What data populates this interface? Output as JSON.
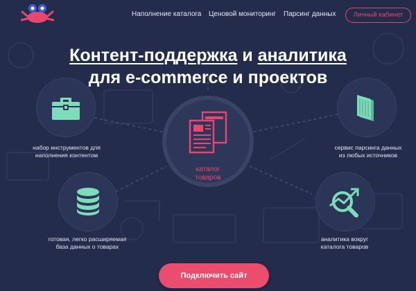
{
  "nav": {
    "links": [
      "Наполнение каталога",
      "Ценовой мониторинг",
      "Парсинг данных"
    ],
    "cabinet_label": "Личный кабинет"
  },
  "hero": {
    "line1_a": "Контент-поддержка",
    "line1_b": " и ",
    "line1_c": "аналитика",
    "line2": "для e-commerce и проектов"
  },
  "features": {
    "tools": [
      "набор инструментов для",
      "наполнения контентом"
    ],
    "parsing": [
      "сервис парсинга данных",
      "из любых источников"
    ],
    "database": [
      "готовая, легко расширяемая",
      "база данных о товарах"
    ],
    "analytics": [
      "аналитика вокруг",
      "каталога товаров"
    ]
  },
  "center": {
    "label": [
      "каталог",
      "товаров"
    ]
  },
  "cta": {
    "label": "Подключить сайт"
  },
  "colors": {
    "background": "#232c4b",
    "accent": "#ea4d6e",
    "icon": "#7fdcb8"
  },
  "icons": [
    "crab-logo-icon",
    "toolbox-icon",
    "documents-icon",
    "database-icon",
    "analytics-chart-icon",
    "catalog-documents-icon"
  ]
}
